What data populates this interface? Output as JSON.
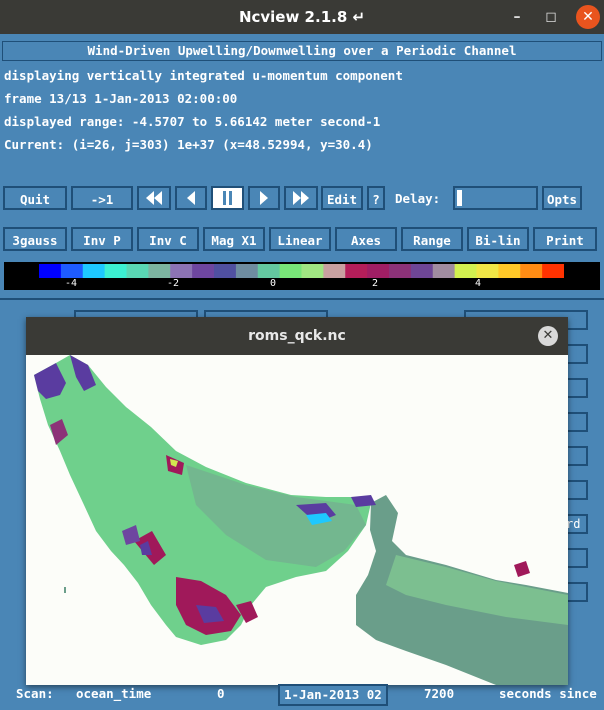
{
  "window": {
    "title": "Ncview 2.1.8 ↵"
  },
  "header": {
    "banner": "Wind-Driven Upwelling/Downwelling over a Periodic Channel",
    "line1": "displaying vertically integrated u-momentum component",
    "line2": "frame 13/13 1-Jan-2013 02:00:00",
    "line3": "displayed range: -4.5707 to 5.66142 meter second-1",
    "line4": "Current: (i=26, j=303) 1e+37 (x=48.52994, y=30.4)"
  },
  "controls": {
    "quit": "Quit",
    "to_first": "->1",
    "edit": "Edit",
    "help": "?",
    "delay_label": "Delay:",
    "opts": "Opts"
  },
  "options": {
    "gauss": "3gauss",
    "invp": "Inv P",
    "invc": "Inv C",
    "mag": "Mag X1",
    "linear": "Linear",
    "axes": "Axes",
    "range": "Range",
    "bilin": "Bi-lin",
    "print": "Print"
  },
  "colorbar": {
    "ticks": [
      "-4",
      "-2",
      "0",
      "2",
      "4"
    ],
    "colors": [
      "#0000ff",
      "#1e5bff",
      "#1ec8ff",
      "#3cf0d2",
      "#5ad7b4",
      "#7cb4a0",
      "#8c73b4",
      "#6e46a0",
      "#5050a0",
      "#6e8ca0",
      "#64c8a0",
      "#78e678",
      "#a0e682",
      "#c8a0a0",
      "#b41e5a",
      "#a01e64",
      "#8c3278",
      "#6e4696",
      "#a08ca0",
      "#d2f050",
      "#f0e646",
      "#ffc828",
      "#ff8c14",
      "#ff3200"
    ]
  },
  "popup": {
    "title": "roms_qck.nc"
  },
  "panel_hidden": {
    "dims_fragment": "rd"
  },
  "scan": {
    "label": "Scan:",
    "dim": "ocean_time",
    "min": "0",
    "current": "1-Jan-2013 02",
    "max": "7200",
    "units": "seconds since"
  },
  "map_colors": {
    "water": "#6fd08c",
    "land": "#fcfdf9",
    "deep": "#6a9e8a",
    "red": "#a0195a",
    "purple": "#5a3ca0",
    "yellow": "#d2e650"
  }
}
